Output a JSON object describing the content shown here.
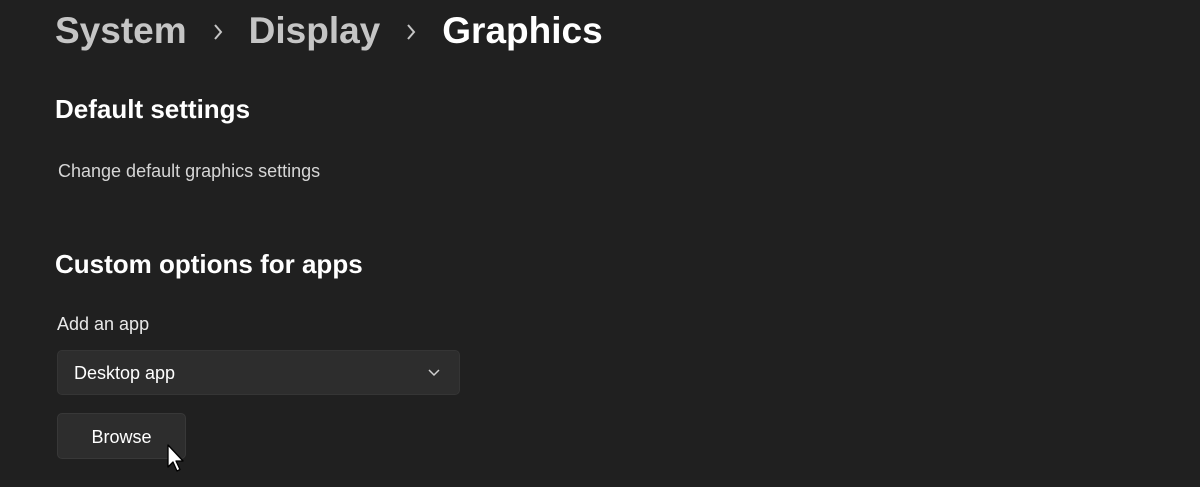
{
  "breadcrumb": {
    "items": [
      "System",
      "Display",
      "Graphics"
    ],
    "separator_icon": "chevron-right-icon"
  },
  "default_settings": {
    "title": "Default settings",
    "link_label": "Change default graphics settings"
  },
  "custom_options": {
    "title": "Custom options for apps",
    "add_app_label": "Add an app",
    "app_type_select": {
      "selected": "Desktop app",
      "icon": "chevron-down-icon"
    },
    "browse_button_label": "Browse"
  },
  "colors": {
    "background": "#202020",
    "control_background": "#2d2d2d",
    "text_primary": "#ffffff",
    "text_secondary": "#c5c5c5"
  }
}
